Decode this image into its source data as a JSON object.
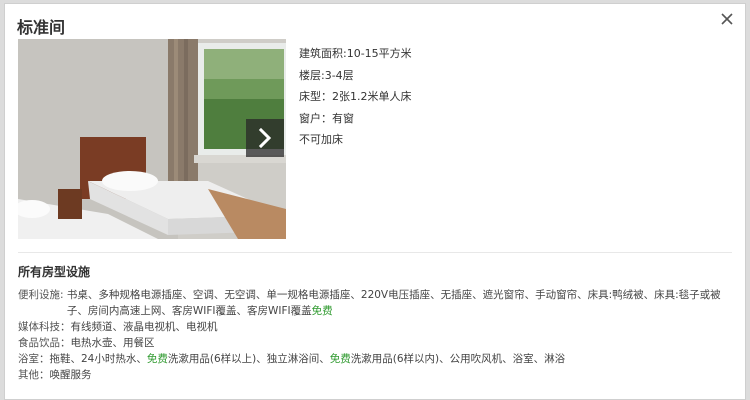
{
  "dialog": {
    "title": "标准间"
  },
  "room_info": [
    "建筑面积:10-15平方米",
    "楼层:3-4层",
    "床型：2张1.2米单人床",
    "窗户：有窗",
    "不可加床"
  ],
  "facilities": {
    "section_title": "所有房型设施",
    "convenience": {
      "label": "便利设施: ",
      "line1": "书桌、多种规格电源插座、空调、无空调、单一规格电源插座、220V电压插座、无插座、遮光窗帘、手动窗帘、床具:鸭绒被、床具:毯子或被",
      "line2a": "子、房间内高速上网、客房WIFI覆盖、客房WIFI覆盖",
      "line2b": "免费"
    },
    "media": {
      "label": "媒体科技：",
      "value": "有线频道、液晶电视机、电视机"
    },
    "food": {
      "label": "食品饮品：",
      "value": "电热水壶、用餐区"
    },
    "bath": {
      "label": "浴室：",
      "part1": "拖鞋、24小时热水、",
      "free1": "免费",
      "part2": "洗漱用品(6样以上)、独立淋浴间、",
      "free2": "免费",
      "part3": "洗漱用品(6样以内)、公用吹风机、浴室、淋浴"
    },
    "other": {
      "label": "其他：",
      "value": "唤醒服务"
    }
  },
  "colors": {
    "free_text": "#2f9a2f",
    "overlay_button": "#282828"
  },
  "icons": {
    "close": "close-icon",
    "next": "chevron-right-icon"
  }
}
